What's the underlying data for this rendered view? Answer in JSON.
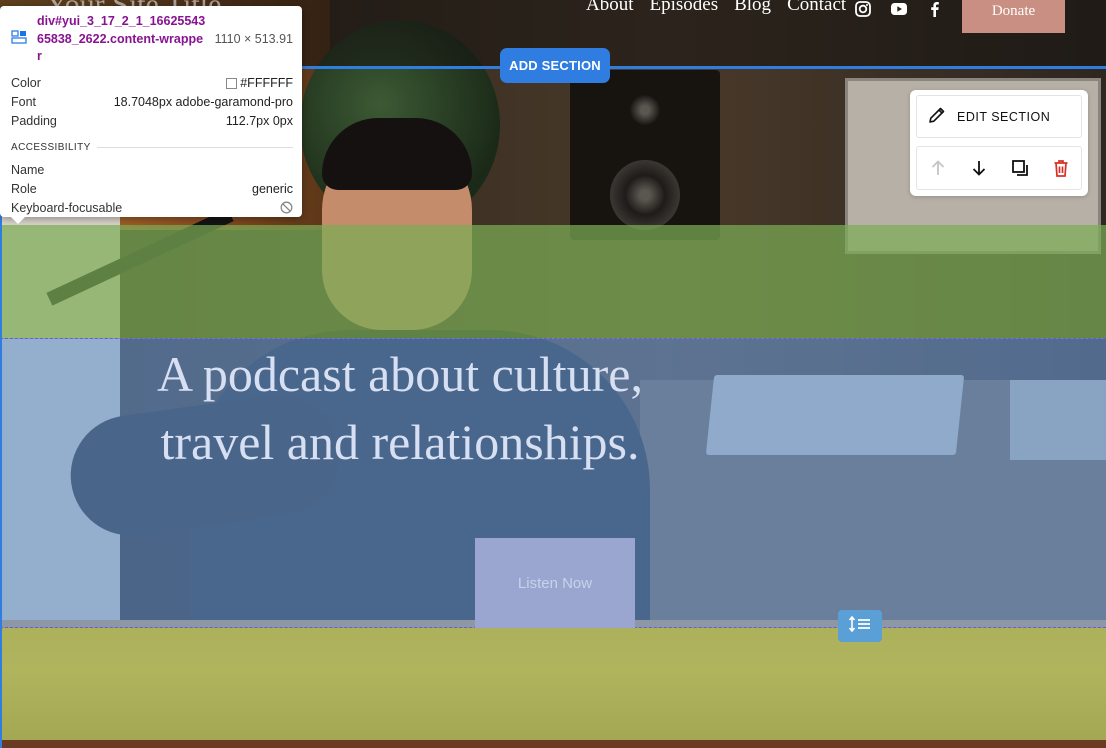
{
  "site": {
    "title": "Your Site Title",
    "nav": [
      "About",
      "Episodes",
      "Blog",
      "Contact"
    ],
    "socials": [
      "instagram-icon",
      "youtube-icon",
      "facebook-icon"
    ],
    "donate_label": "Donate"
  },
  "hero": {
    "title_line1": "A podcast about culture,",
    "title_line2": "travel and relationships.",
    "cta_label": "Listen Now"
  },
  "editor": {
    "add_section_label": "ADD SECTION",
    "edit_section_label": "EDIT SECTION",
    "accent_color": "#2f7de1",
    "delete_color": "#d93025"
  },
  "devtools": {
    "selector": "div#yui_3_17_2_1_1662554365838_2622.content-wrapper",
    "dimensions": "1110 × 513.91",
    "rows": [
      {
        "label": "Color",
        "value": "#FFFFFF"
      },
      {
        "label": "Font",
        "value": "18.7048px adobe-garamond-pro"
      },
      {
        "label": "Padding",
        "value": "112.7px 0px"
      }
    ],
    "section_label": "ACCESSIBILITY",
    "a11y_rows": [
      {
        "label": "Name",
        "value": ""
      },
      {
        "label": "Role",
        "value": "generic"
      },
      {
        "label": "Keyboard-focusable",
        "value": ""
      }
    ]
  }
}
